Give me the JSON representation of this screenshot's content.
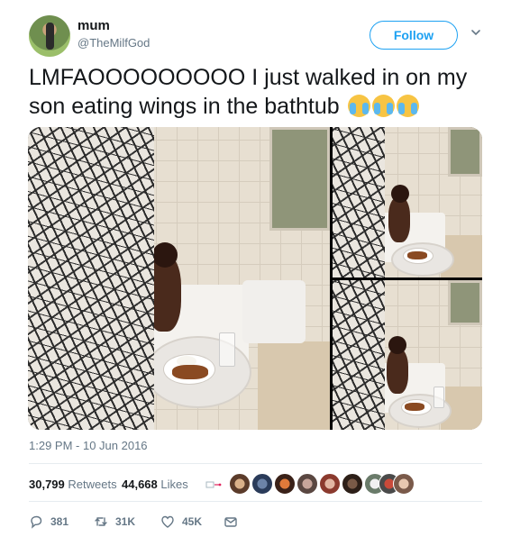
{
  "user": {
    "display_name": "mum",
    "handle": "@TheMilfGod",
    "avatar_icon": "profile-photo"
  },
  "follow_label": "Follow",
  "tweet": {
    "text": "LMFAOOOOOOOOO I just walked in on my son eating wings in the bathtub",
    "emojis": [
      "loudly-crying-face",
      "loudly-crying-face",
      "loudly-crying-face"
    ]
  },
  "media": {
    "photos": [
      "photo-boy-in-bathtub-wide",
      "photo-boy-in-bathtub-top",
      "photo-boy-in-bathtub-bottom"
    ]
  },
  "timestamp": "1:29 PM - 10 Jun 2016",
  "stats": {
    "retweets_count": "30,799",
    "retweets_label": "Retweets",
    "likes_count": "44,668",
    "likes_label": "Likes"
  },
  "likers": {
    "count_shown": 9
  },
  "actions": {
    "reply_count": "381",
    "retweet_count": "31K",
    "like_count": "45K"
  },
  "colors": {
    "accent": "#1da1f2",
    "muted": "#657786",
    "text": "#14171a"
  }
}
